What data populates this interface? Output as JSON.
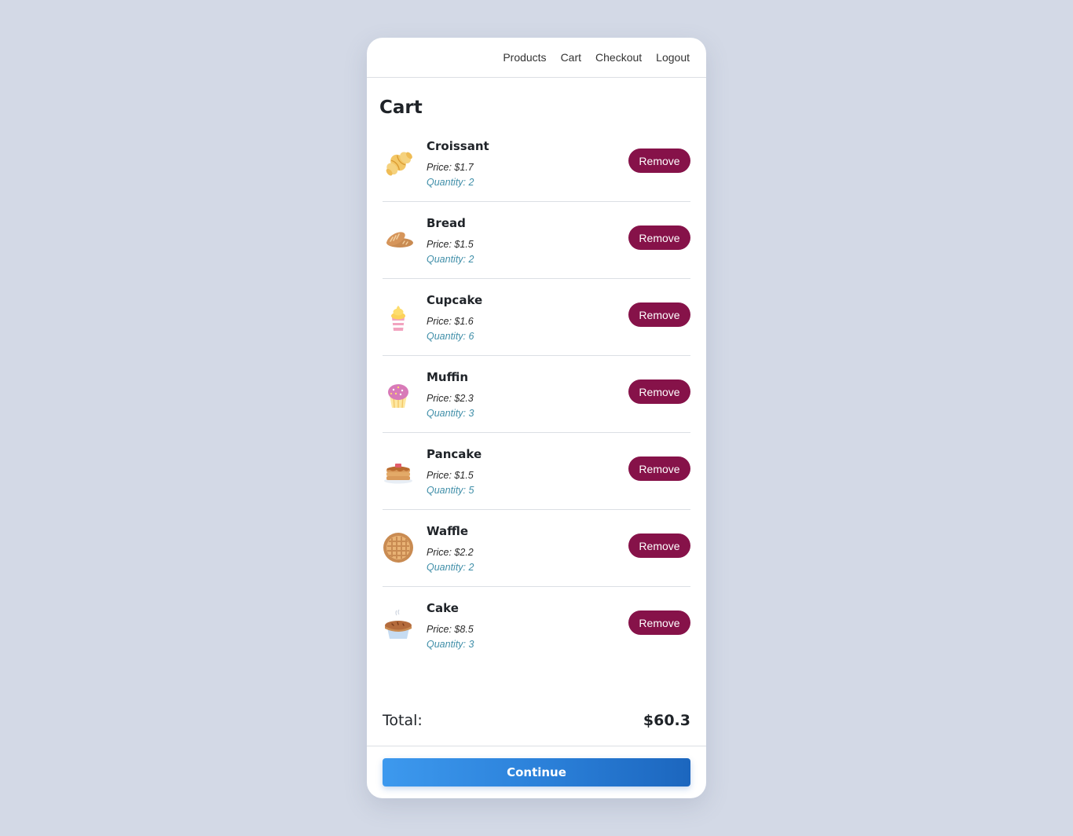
{
  "nav": {
    "links": [
      {
        "label": "Products"
      },
      {
        "label": "Cart"
      },
      {
        "label": "Checkout"
      },
      {
        "label": "Logout"
      }
    ]
  },
  "page_title": "Cart",
  "items": [
    {
      "name": "Croissant",
      "price": "Price: $1.7",
      "quantity": "Quantity: 2",
      "icon": "croissant-icon",
      "remove_label": "Remove"
    },
    {
      "name": "Bread",
      "price": "Price: $1.5",
      "quantity": "Quantity: 2",
      "icon": "bread-icon",
      "remove_label": "Remove"
    },
    {
      "name": "Cupcake",
      "price": "Price: $1.6",
      "quantity": "Quantity: 6",
      "icon": "cupcake-icon",
      "remove_label": "Remove"
    },
    {
      "name": "Muffin",
      "price": "Price: $2.3",
      "quantity": "Quantity: 3",
      "icon": "muffin-icon",
      "remove_label": "Remove"
    },
    {
      "name": "Pancake",
      "price": "Price: $1.5",
      "quantity": "Quantity: 5",
      "icon": "pancake-icon",
      "remove_label": "Remove"
    },
    {
      "name": "Waffle",
      "price": "Price: $2.2",
      "quantity": "Quantity: 2",
      "icon": "waffle-icon",
      "remove_label": "Remove"
    },
    {
      "name": "Cake",
      "price": "Price: $8.5",
      "quantity": "Quantity: 3",
      "icon": "pie-icon",
      "remove_label": "Remove"
    }
  ],
  "total": {
    "label": "Total:",
    "value": "$60.3"
  },
  "continue_label": "Continue",
  "colors": {
    "background": "#d3d9e6",
    "remove_button": "#861249",
    "quantity_text": "#3f8ea8",
    "continue_gradient_start": "#3d99ee",
    "continue_gradient_end": "#1c66be"
  }
}
